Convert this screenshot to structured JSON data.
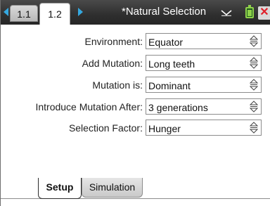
{
  "titlebar": {
    "tabs": [
      {
        "label": "1.1"
      },
      {
        "label": "1.2"
      }
    ],
    "document_title": "*Natural Selection",
    "colors": {
      "accent": "#35a8e0",
      "close": "#e0202a",
      "battery": "#8fd04a"
    }
  },
  "form": {
    "fields": [
      {
        "label": "Environment:",
        "value": "Equator"
      },
      {
        "label": "Add Mutation:",
        "value": "Long teeth"
      },
      {
        "label": "Mutation is:",
        "value": "Dominant"
      },
      {
        "label": "Introduce Mutation After:",
        "value": "3 generations"
      },
      {
        "label": "Selection Factor:",
        "value": "Hunger"
      }
    ]
  },
  "sheet_tabs": [
    {
      "label": "Setup",
      "active": true
    },
    {
      "label": "Simulation",
      "active": false
    }
  ],
  "icons": [
    "left-arrow-icon",
    "right-arrow-icon",
    "dropdown-chevron-icon",
    "battery-icon",
    "close-icon",
    "spinner-updown-icon"
  ]
}
